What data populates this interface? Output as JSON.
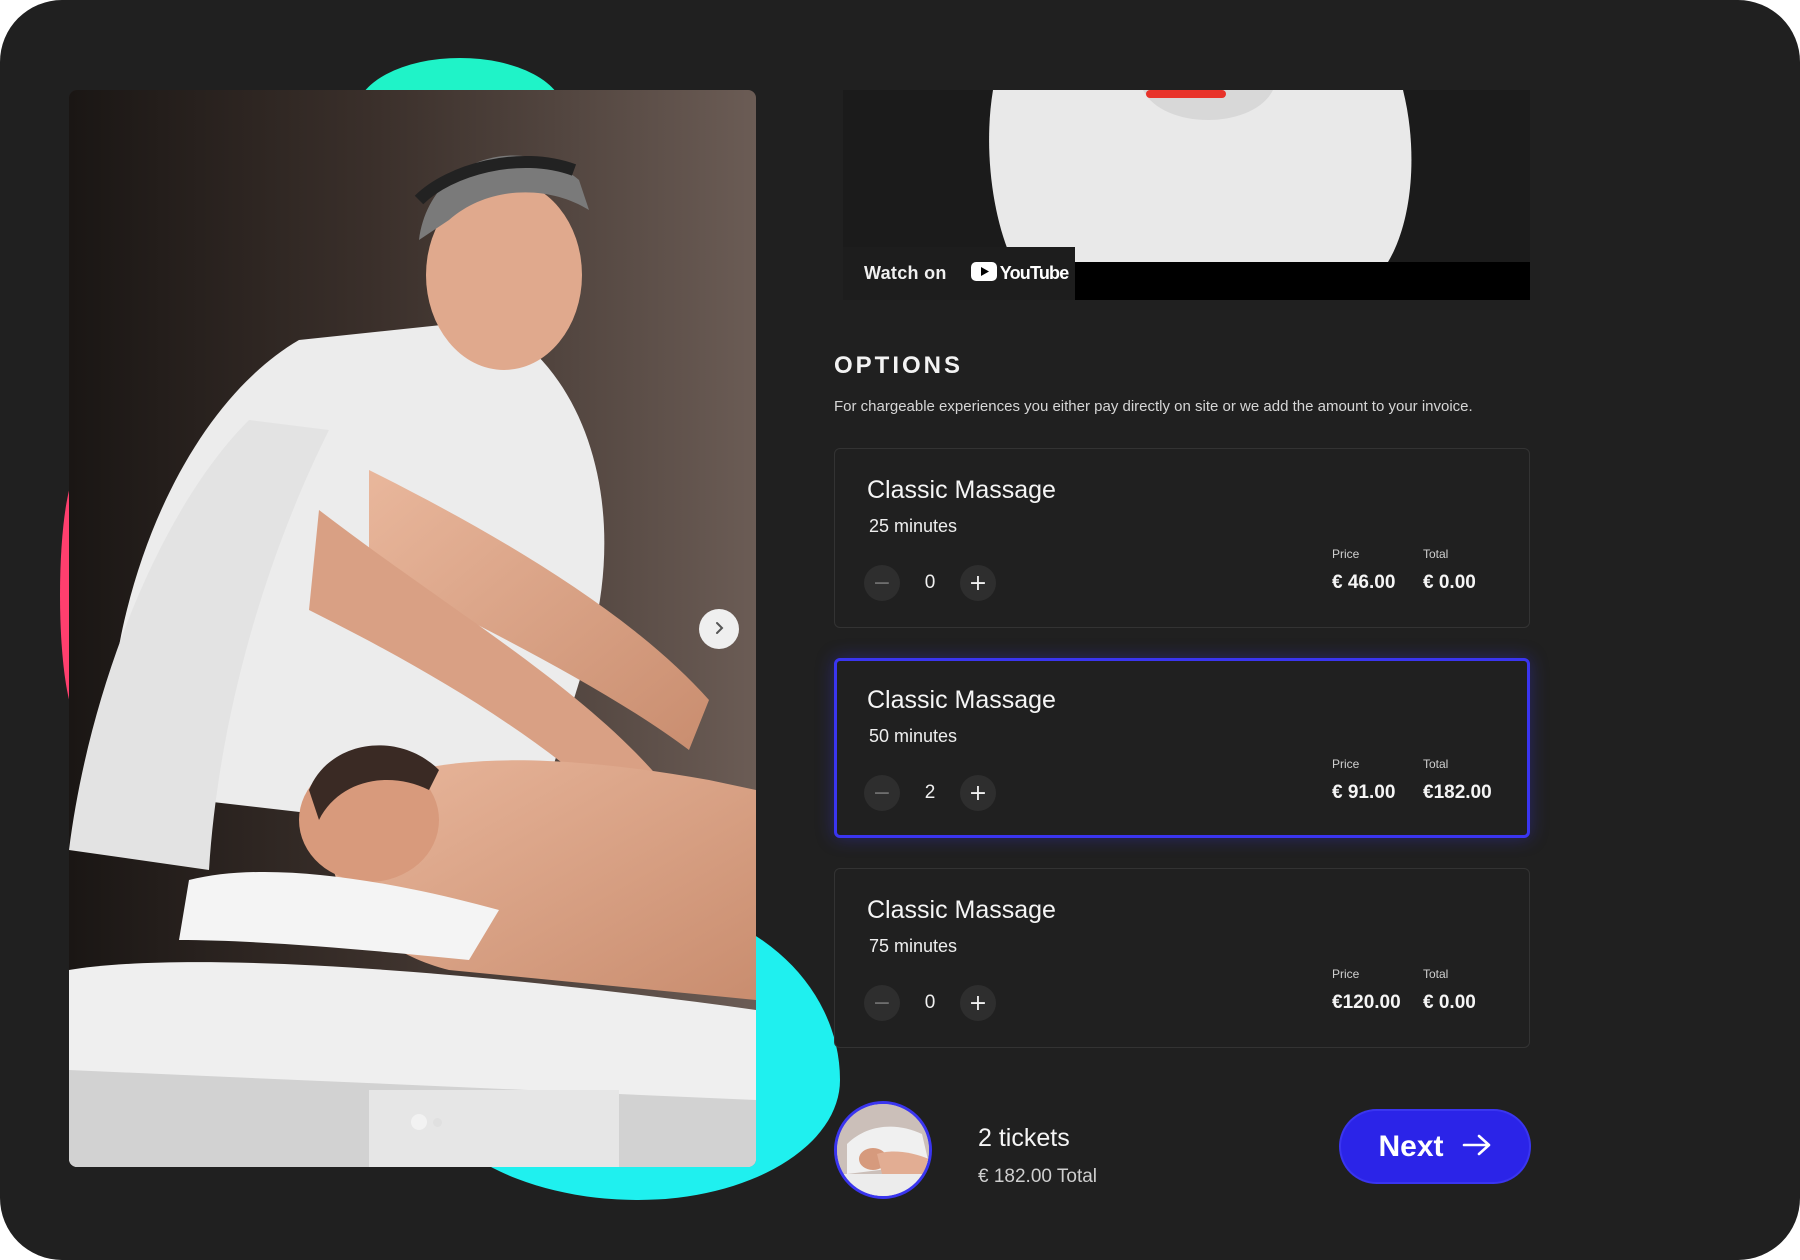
{
  "video": {
    "watch_on": "Watch on",
    "youtube_label": "YouTube"
  },
  "options": {
    "title": "OPTIONS",
    "description": "For chargeable experiences you either pay directly on site or we add the amount to your invoice.",
    "price_label": "Price",
    "total_label": "Total",
    "items": [
      {
        "name": "Classic Massage",
        "duration": "25 minutes",
        "quantity": "0",
        "price": "€ 46.00",
        "total": "€ 0.00",
        "selected": false
      },
      {
        "name": "Classic Massage",
        "duration": "50 minutes",
        "quantity": "2",
        "price": "€ 91.00",
        "total": "€182.00",
        "selected": true
      },
      {
        "name": "Classic Massage",
        "duration": "75 minutes",
        "quantity": "0",
        "price": "€120.00",
        "total": "€ 0.00",
        "selected": false
      }
    ]
  },
  "summary": {
    "tickets": "2 tickets",
    "total": "€  182.00 Total"
  },
  "next_button": {
    "label": "Next"
  },
  "carousel": {
    "slide_count": 2,
    "active_slide": 1
  },
  "colors": {
    "background": "#202020",
    "accent": "#2b24e8",
    "teal": "#1ff3c8",
    "cyan": "#1ff0ef",
    "pink": "#ff3f6e"
  },
  "icons": {
    "next_slide": "chevron-right-icon",
    "decrement": "minus-icon",
    "increment": "plus-icon",
    "next": "arrow-right-icon",
    "youtube": "youtube-logo-icon"
  }
}
